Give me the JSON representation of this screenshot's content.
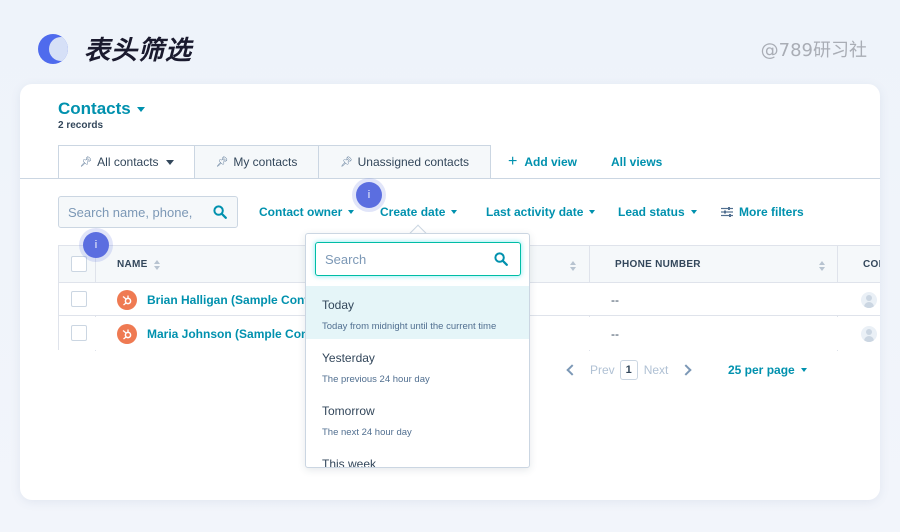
{
  "header": {
    "title": "表头筛选",
    "watermark": "@789研习社"
  },
  "crm": {
    "object_title": "Contacts",
    "record_count": "2 records",
    "tabs": [
      {
        "label": "All contacts",
        "active": true
      },
      {
        "label": "My contacts",
        "active": false
      },
      {
        "label": "Unassigned contacts",
        "active": false
      }
    ],
    "add_view": "Add view",
    "all_views": "All views",
    "search_placeholder": "Search name, phone,",
    "filters": {
      "contact_owner": "Contact owner",
      "create_date": "Create date",
      "last_activity_date": "Last activity date",
      "lead_status": "Lead status",
      "more_filters": "More filters"
    },
    "info_marker": "i",
    "table": {
      "columns": [
        "NAME",
        "PHONE NUMBER",
        "CON"
      ],
      "rows": [
        {
          "name": "Brian Halligan (Sample Contact)",
          "phone": "--"
        },
        {
          "name": "Maria Johnson (Sample Contact)",
          "phone": "--"
        }
      ]
    },
    "pagination": {
      "prev": "Prev",
      "current": "1",
      "next": "Next",
      "per_page": "25 per page"
    },
    "dropdown": {
      "search_placeholder": "Search",
      "options": [
        {
          "label": "Today",
          "description": "Today from midnight until the current time",
          "highlighted": true
        },
        {
          "label": "Yesterday",
          "description": "The previous 24 hour day",
          "highlighted": false
        },
        {
          "label": "Tomorrow",
          "description": "The next 24 hour day",
          "highlighted": false
        },
        {
          "label": "This week",
          "description": "",
          "highlighted": false
        }
      ]
    }
  },
  "colors": {
    "link": "#0091ae",
    "text": "#33475b",
    "accent_badge": "#ef7a52",
    "info_bubble": "#5b6ee0",
    "focus_border": "#00bda5",
    "highlight_row": "#e5f5f8"
  },
  "icons": [
    "app-logo-icon",
    "pin-icon",
    "plus-icon",
    "search-icon",
    "caret-down-icon",
    "sliders-icon",
    "sort-icon",
    "hubspot-sprocket-icon",
    "person-icon",
    "chevron-left-icon",
    "chevron-right-icon"
  ]
}
